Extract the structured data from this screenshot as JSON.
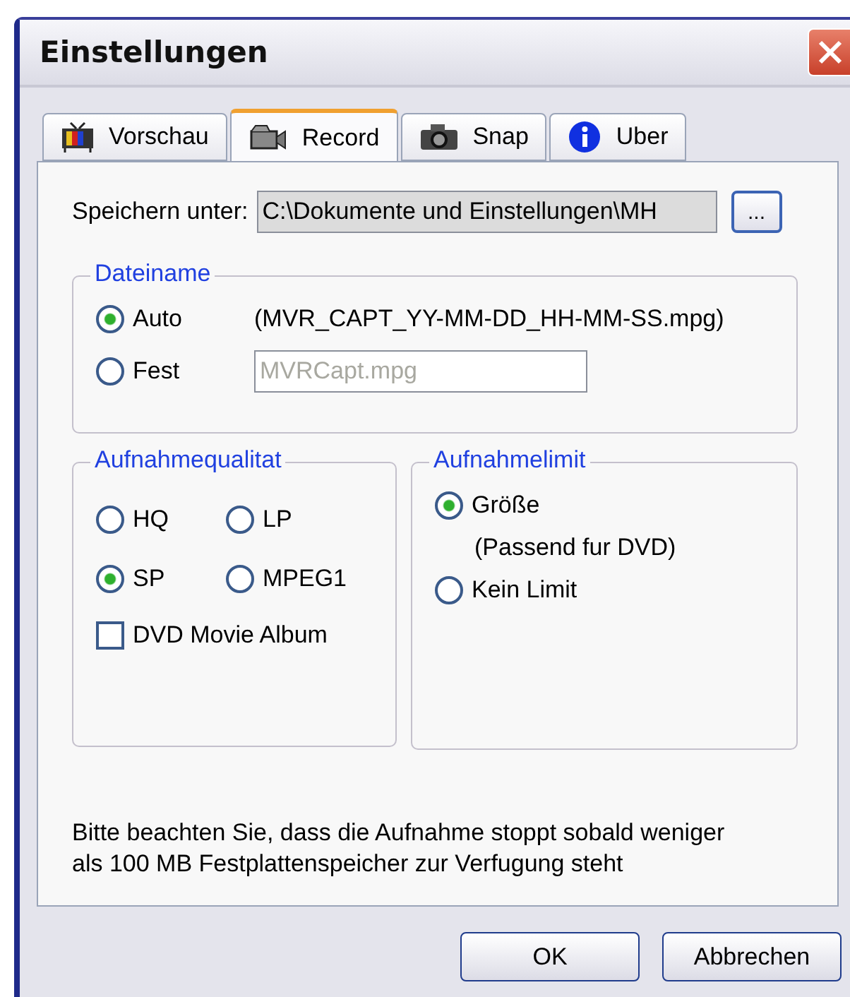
{
  "window": {
    "title": "Einstellungen"
  },
  "tabs": [
    {
      "label": "Vorschau",
      "kind": "tv",
      "selected": false
    },
    {
      "label": "Record",
      "kind": "camcorder",
      "selected": true
    },
    {
      "label": "Snap",
      "kind": "camera",
      "selected": false
    },
    {
      "label": "Uber",
      "kind": "info",
      "selected": false
    }
  ],
  "save_path": {
    "label": "Speichern unter:",
    "value": "C:\\Dokumente und Einstellungen\\MH",
    "browse_button": "..."
  },
  "filename_group": {
    "title": "Dateiname",
    "options": [
      {
        "label": "Auto",
        "selected": true,
        "detail": "(MVR_CAPT_YY-MM-DD_HH-MM-SS.mpg)"
      },
      {
        "label": "Fest",
        "selected": false,
        "field": {
          "value": "MVRCapt.mpg",
          "disabled": true
        }
      }
    ]
  },
  "quality_group": {
    "title": "Aufnahmequalitat",
    "options": [
      {
        "label": "HQ",
        "selected": false
      },
      {
        "label": "LP",
        "selected": false
      },
      {
        "label": "SP",
        "selected": true
      },
      {
        "label": "MPEG1",
        "selected": false
      }
    ],
    "checkbox": {
      "label": "DVD Movie Album",
      "checked": false
    }
  },
  "limit_group": {
    "title": "Aufnahmelimit",
    "options": [
      {
        "label": "Größe",
        "selected": true,
        "note": "(Passend fur DVD)"
      },
      {
        "label": "Kein Limit",
        "selected": false
      }
    ]
  },
  "note": "Bitte beachten Sie, dass die Aufnahme stoppt sobald weniger als 100 MB Festplattenspeicher zur Verfugung steht",
  "buttons": [
    "OK",
    "Abbrechen"
  ]
}
